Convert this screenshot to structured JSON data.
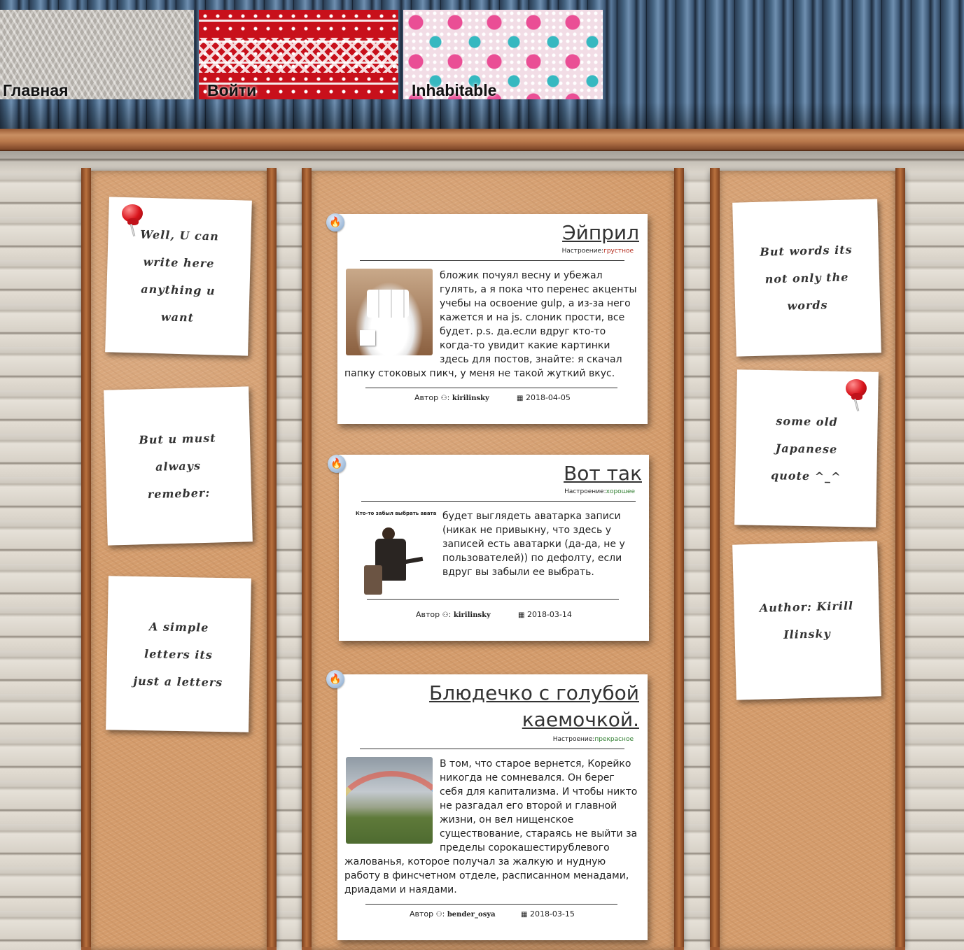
{
  "nav": {
    "home": "Главная",
    "login": "Войти",
    "site": "Inhabitable"
  },
  "left_notes": [
    "Well, U can write here anything u want",
    "But u must always remeber:",
    "A simple letters its just a letters"
  ],
  "right_notes": [
    "But words its not only the words",
    "some old Japanese quote ^_^",
    "Author: Kirill Ilinsky"
  ],
  "posts": [
    {
      "title": "Эйприл",
      "mood_label": "Настроение:",
      "mood": "грустное",
      "mood_color": "#b42b1c",
      "text": "бложик почуял весну и убежал гулять, а я пока что перенес акценты учебы на освоение gulp, а из-за него кажется и на js. слоник прости, все будет. p.s. да.если вдруг кто-то когда-то увидит какие картинки здесь для постов, знайте: я скачал папку стоковых пикч, у меня не такой жуткий вкус.",
      "author_label": "Автор",
      "author": "kirilinsky",
      "date": "2018-04-05",
      "image": "sugar-cubes-bowl"
    },
    {
      "title": "Вот так",
      "mood_label": "Настроение:",
      "mood": "хорошее",
      "mood_color": "#2f7d2f",
      "text": "будет выглядеть аватарка записи (никак не привыкну, что здесь у записей есть аватарки (да-да, не у пользователей)) по дефолту, если вдруг вы забыли ее выбрать.",
      "image_caption": "Кто-то забыл выбрать аватар...",
      "author_label": "Автор",
      "author": "kirilinsky",
      "date": "2018-03-14",
      "image": "confused-man-meme"
    },
    {
      "title": "Блюдечко с голубой каемочкой.",
      "mood_label": "Настроение:",
      "mood": "прекрасное",
      "mood_color": "#2f7d2f",
      "text": "В том, что старое вернется, Корейко никогда не сомневался. Он берег себя для капитализма. И чтобы никто не разгадал его второй и главной жизни, он вел нищенское существование, стараясь не выйти за пределы сорокашестирублевого жалованья, которое получал за жалкую и нудную работу в финсчетном отделе, расписанном менадами, дриадами и наядами.",
      "author_label": "Автор",
      "author": "bender_osya",
      "date": "2018-03-15",
      "image": "rainbow-field"
    }
  ],
  "icons": {
    "fire": "🔥",
    "user": "👤",
    "calendar": "▦"
  }
}
